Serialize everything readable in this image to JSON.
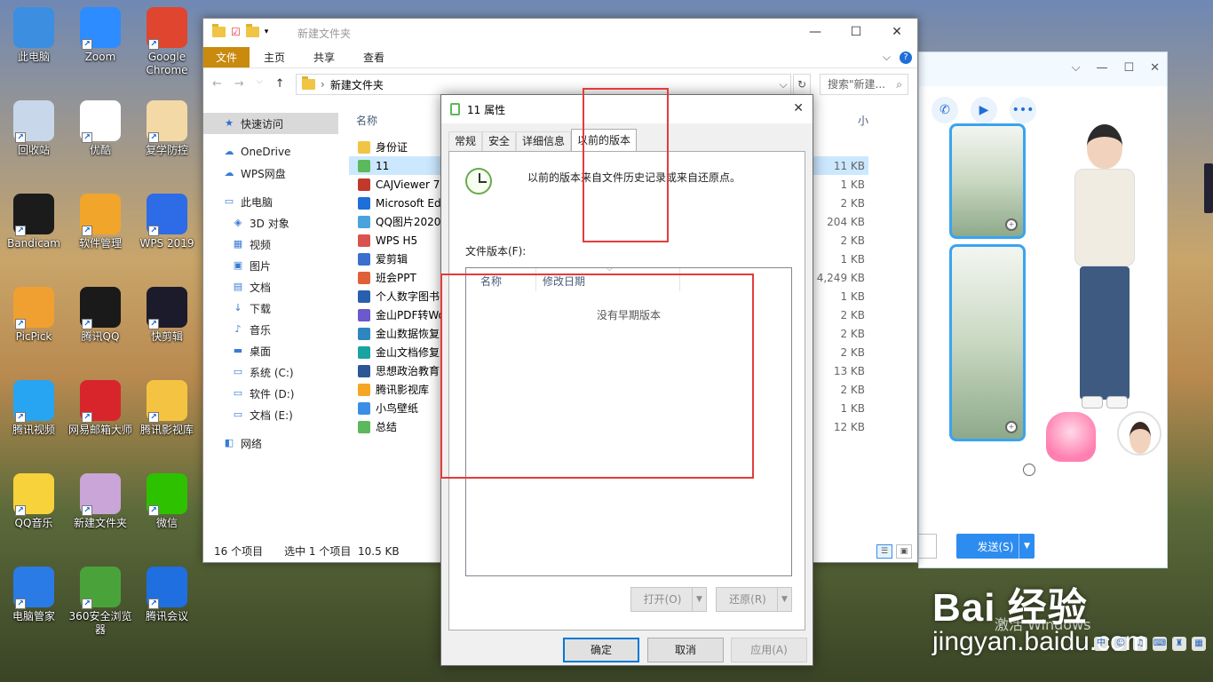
{
  "desktop": {
    "icons": [
      {
        "label": "此电脑",
        "color": "#3c8ee0"
      },
      {
        "label": "Zoom",
        "color": "#2d8cff"
      },
      {
        "label": "Google Chrome",
        "color": "#e0452f"
      },
      {
        "label": "回收站",
        "color": "#c8d8ea"
      },
      {
        "label": "优酷",
        "color": "#ffffff"
      },
      {
        "label": "复学防控",
        "color": "#f3d9a6"
      },
      {
        "label": "Bandicam",
        "color": "#1b1b1b"
      },
      {
        "label": "软件管理",
        "color": "#f2a52b"
      },
      {
        "label": "WPS 2019",
        "color": "#2e6be6"
      },
      {
        "label": "PicPick",
        "color": "#f0a030"
      },
      {
        "label": "腾讯QQ",
        "color": "#1a1a1a"
      },
      {
        "label": "快剪辑",
        "color": "#1b1b2b"
      },
      {
        "label": "腾讯视频",
        "color": "#27a5f2"
      },
      {
        "label": "网易邮箱大师",
        "color": "#d8252c"
      },
      {
        "label": "腾讯影视库",
        "color": "#f5c342"
      },
      {
        "label": "QQ音乐",
        "color": "#f7d23a"
      },
      {
        "label": "新建文件夹",
        "color": "#caa5d8"
      },
      {
        "label": "微信",
        "color": "#2dc100"
      },
      {
        "label": "电脑管家",
        "color": "#2a7be6"
      },
      {
        "label": "360安全浏览器",
        "color": "#4aa33a"
      },
      {
        "label": "腾讯会议",
        "color": "#1f6fe0"
      }
    ]
  },
  "explorer": {
    "title": "新建文件夹",
    "ribbon_tabs": [
      "文件",
      "主页",
      "共享",
      "查看"
    ],
    "address": "新建文件夹",
    "search_placeholder": "搜索\"新建...",
    "nav_items": [
      {
        "label": "快速访问",
        "icon": "★",
        "level": 0,
        "selected": true
      },
      {
        "label": "OneDrive",
        "icon": "☁",
        "level": 0
      },
      {
        "label": "WPS网盘",
        "icon": "☁",
        "level": 0
      },
      {
        "label": "此电脑",
        "icon": "▭",
        "level": 0
      },
      {
        "label": "3D 对象",
        "icon": "◈",
        "level": 1
      },
      {
        "label": "视频",
        "icon": "▦",
        "level": 1
      },
      {
        "label": "图片",
        "icon": "▣",
        "level": 1
      },
      {
        "label": "文档",
        "icon": "▤",
        "level": 1
      },
      {
        "label": "下载",
        "icon": "↓",
        "level": 1
      },
      {
        "label": "音乐",
        "icon": "♪",
        "level": 1
      },
      {
        "label": "桌面",
        "icon": "▬",
        "level": 1
      },
      {
        "label": "系统 (C:)",
        "icon": "▭",
        "level": 1
      },
      {
        "label": "软件 (D:)",
        "icon": "▭",
        "level": 1
      },
      {
        "label": "文档 (E:)",
        "icon": "▭",
        "level": 1
      },
      {
        "label": "网络",
        "icon": "◧",
        "level": 0
      }
    ],
    "column_name": "名称",
    "column_size": "小",
    "files": [
      {
        "name": "身份证",
        "size": "",
        "color": "#f0c444"
      },
      {
        "name": "11",
        "size": "11 KB",
        "color": "#5cb85c",
        "selected": true
      },
      {
        "name": "CAJViewer 7.",
        "size": "1 KB",
        "color": "#c0392b"
      },
      {
        "name": "Microsoft Ed",
        "size": "2 KB",
        "color": "#1e6fd9"
      },
      {
        "name": "QQ图片20200",
        "size": "204 KB",
        "color": "#4aa3df"
      },
      {
        "name": "WPS H5",
        "size": "2 KB",
        "color": "#d9534f"
      },
      {
        "name": "爱剪辑",
        "size": "1 KB",
        "color": "#3a6fd0"
      },
      {
        "name": "班会PPT",
        "size": "4,249 KB",
        "color": "#e0603a"
      },
      {
        "name": "个人数字图书",
        "size": "1 KB",
        "color": "#2a5fb0"
      },
      {
        "name": "金山PDF转Wo",
        "size": "2 KB",
        "color": "#6a5acd"
      },
      {
        "name": "金山数据恢复",
        "size": "2 KB",
        "color": "#2e86c1"
      },
      {
        "name": "金山文档修复",
        "size": "2 KB",
        "color": "#1aa3a3"
      },
      {
        "name": "思想政治教育",
        "size": "13 KB",
        "color": "#2b5797"
      },
      {
        "name": "腾讯影视库",
        "size": "2 KB",
        "color": "#f5a623"
      },
      {
        "name": "小鸟壁纸",
        "size": "1 KB",
        "color": "#3a8ee6"
      },
      {
        "name": "总结",
        "size": "12 KB",
        "color": "#5cb85c"
      }
    ],
    "status_count": "16 个项目",
    "status_selected": "选中 1 个项目",
    "status_size": "10.5 KB"
  },
  "props": {
    "title": "11 属性",
    "tabs": [
      "常规",
      "安全",
      "详细信息",
      "以前的版本"
    ],
    "description": "以前的版本来自文件历史记录或来自还原点。",
    "file_versions_label": "文件版本(F):",
    "col_name": "名称",
    "col_date": "修改日期",
    "empty_text": "没有早期版本",
    "open_btn": "打开(O)",
    "restore_btn": "还原(R)",
    "ok": "确定",
    "cancel": "取消",
    "apply": "应用(A)"
  },
  "chat": {
    "send": "发送(S)",
    "partial_btn": "C)"
  },
  "watermark": {
    "brand": "Bai 经验",
    "url": "jingyan.baidu.com",
    "activate": "激活 Windows"
  }
}
